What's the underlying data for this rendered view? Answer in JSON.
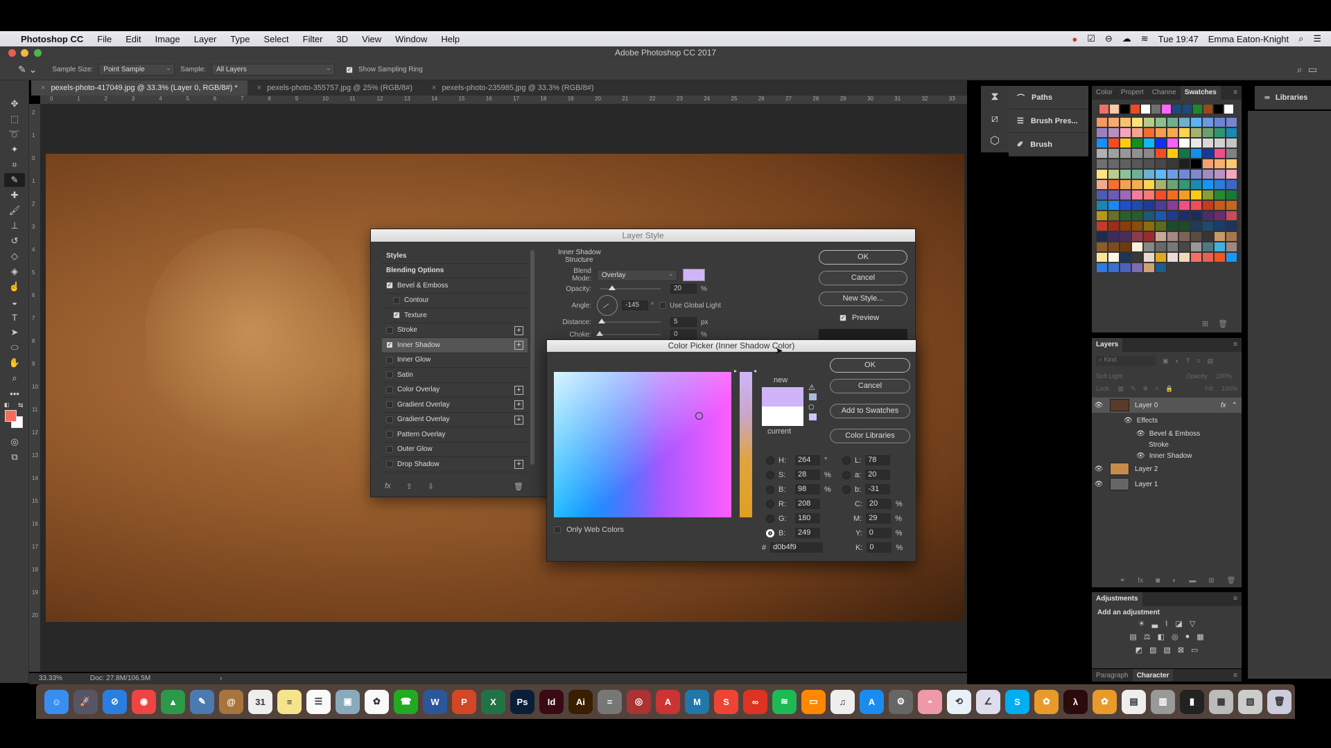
{
  "menubar": {
    "apple": "",
    "app": "Photoshop CC",
    "items": [
      "File",
      "Edit",
      "Image",
      "Layer",
      "Type",
      "Select",
      "Filter",
      "3D",
      "View",
      "Window",
      "Help"
    ],
    "clock": "Tue 19:47",
    "user": "Emma Eaton-Knight"
  },
  "window": {
    "title": "Adobe Photoshop CC 2017"
  },
  "options": {
    "sample_size_label": "Sample Size:",
    "sample_size_value": "Point Sample",
    "sample_label": "Sample:",
    "sample_value": "All Layers",
    "show_ring_label": "Show Sampling Ring",
    "show_ring_checked": true
  },
  "tabs": [
    {
      "label": "pexels-photo-417049.jpg @ 33.3% (Layer 0, RGB/8#) *",
      "active": true
    },
    {
      "label": "pexels-photo-355757.jpg @ 25% (RGB/8#)",
      "active": false
    },
    {
      "label": "pexels-photo-235985.jpg @ 33.3% (RGB/8#)",
      "active": false
    }
  ],
  "ruler_top": [
    "0",
    "1",
    "2",
    "3",
    "4",
    "5",
    "6",
    "7",
    "8",
    "9",
    "10",
    "11",
    "12",
    "13",
    "14",
    "15",
    "16",
    "17",
    "18",
    "19",
    "20",
    "21",
    "22",
    "23",
    "24",
    "25",
    "26",
    "27",
    "28",
    "29",
    "30",
    "31",
    "32",
    "33"
  ],
  "ruler_left": [
    "2",
    "1",
    "0",
    "1",
    "2",
    "3",
    "4",
    "5",
    "6",
    "7",
    "8",
    "9",
    "10",
    "11",
    "12",
    "13",
    "14",
    "15",
    "16",
    "17",
    "18",
    "19",
    "20"
  ],
  "status": {
    "zoom": "33.33%",
    "doc": "Doc: 27.8M/106.5M",
    "arrow": "›"
  },
  "colors": {
    "foreground": "#f26b5b",
    "background": "#ffffff",
    "accent": "#d0b4f9"
  },
  "collapsed_panels": [
    {
      "icon": "paths-icon",
      "label": "Paths"
    },
    {
      "icon": "brush-presets-icon",
      "label": "Brush Pres..."
    },
    {
      "icon": "brush-icon",
      "label": "Brush"
    }
  ],
  "color_panel": {
    "tabs": [
      "Color",
      "Propert",
      "Channe",
      "Swatches"
    ],
    "active_tab": "Swatches",
    "recent": [
      "#f07068",
      "#f6cba8",
      "#000000",
      "#f04a20",
      "#ffffff",
      "#707070",
      "#ff66ff",
      "#1c4a7a",
      "#1c4a7a",
      "#1a8a2a",
      "#9a4a1a",
      "#000000",
      "#ffffff"
    ],
    "swatches": [
      [
        "#f69862",
        "#f8a870",
        "#f9c070",
        "#fce27a",
        "#b8cc8a",
        "#8cc090",
        "#70ae90",
        "#6cb0d0",
        "#5cb4f4",
        "#6c9ae0",
        "#6c84d8",
        "#7884cc"
      ],
      [
        "#9c80c4",
        "#b890c0",
        "#f4a4bc",
        "#f6a48c",
        "#f46c30",
        "#f69c4c",
        "#f6a84c",
        "#fcd44c",
        "#a4b46c",
        "#6ca070",
        "#309470",
        "#1888b4"
      ],
      [
        "#1890f8",
        "#f44c20",
        "#fccc10",
        "#109020",
        "#10b8f4",
        "#1030f8",
        "#f860f8",
        "#ffffff",
        "#e8e8e8",
        "#d8d8d8",
        "#d0d0d0",
        "#c4c4c4"
      ],
      [
        "#b0b0b0",
        "#a0a0a0",
        "#989898",
        "#909090",
        "#888888",
        "#f44c20",
        "#fcc810",
        "#107848",
        "#1090f0",
        "#1838a0",
        "#f44c88",
        "#808080"
      ],
      [
        "#707070",
        "#686868",
        "#606060",
        "#585858",
        "#505050",
        "#484848",
        "#383838",
        "#202020",
        "#000000",
        "#f6a070",
        "#f6b070",
        "#f8c878"
      ],
      [
        "#fce484",
        "#b8cc8c",
        "#8cc098",
        "#70b098",
        "#6cb0d4",
        "#60b8f8",
        "#6c9ce4",
        "#7088d8",
        "#8088cc",
        "#a08cc4",
        "#b894c4",
        "#f4a8c0"
      ],
      [
        "#f6a890",
        "#f47030",
        "#f6a050",
        "#f6ac50",
        "#fcd450",
        "#a4b470",
        "#6ca274",
        "#309874",
        "#188cb4",
        "#1894f8",
        "#2c7cdc",
        "#3c68c4"
      ],
      [
        "#4c5cb4",
        "#6c5cb4",
        "#9c68b8",
        "#f47c9c",
        "#f47c74",
        "#f44c28",
        "#f46c20",
        "#f69c20",
        "#fccc10",
        "#88a030",
        "#288a30",
        "#187838"
      ],
      [
        "#1888b0",
        "#1888f8",
        "#1c50d0",
        "#1c4cb0",
        "#1c3c98",
        "#4c3c98",
        "#8c3c98",
        "#f44c88",
        "#f44c58",
        "#c43c1c",
        "#c45c1c",
        "#c4661c"
      ],
      [
        "#b8981c",
        "#687028",
        "#28602c",
        "#285c2c",
        "#1c5878",
        "#1c58b0",
        "#1c3c8c",
        "#1c2c6c",
        "#1c2c5c",
        "#4c2c6c",
        "#6c2c6c",
        "#c44c5c"
      ],
      [
        "#c43c28",
        "#9c2c1c",
        "#8c3c0c",
        "#8c4c0c",
        "#8c6c0c",
        "#5c6c1c",
        "#1c4c28",
        "#1c4c28",
        "#1c3c5c",
        "#1c4c6c",
        "#1c3c6c",
        "#1c3458"
      ],
      [
        "#1c2c4c",
        "#3c2c5c",
        "#4c2c5c",
        "#8c3c4c",
        "#9c2c2c",
        "#c8a898",
        "#a88880",
        "#7c6458",
        "#5c4c40",
        "#3c3430",
        "#c89868",
        "#a8784c"
      ],
      [
        "#8c5c2c",
        "#7c4c1c",
        "#6c3c0c",
        "#fff0d8",
        "#888888",
        "#686868",
        "#787878",
        "#484848",
        "#989898",
        "#507880",
        "#40b0e0",
        "#a08880"
      ],
      [
        "#fce49c",
        "#fff8e8",
        "#1c3458",
        "#383838",
        "#e8d8d0",
        "#e0a820",
        "#e8dcd4",
        "#f4d8b8",
        "#f47064",
        "#e86050",
        "#f45420",
        "#1898f8"
      ],
      [
        "#2c7ce0",
        "#3c70d0",
        "#4c60c0",
        "#7c6cb0",
        "#d0a070",
        "#1c5c90"
      ]
    ]
  },
  "libraries": {
    "label": "Libraries"
  },
  "layers": {
    "title": "Layers",
    "filter_placeholder": "Kind",
    "blend_mode": "Soft Light",
    "opacity_label": "Opacity:",
    "opacity_value": "100%",
    "lock_label": "Lock:",
    "fill_label": "Fill:",
    "fill_value": "100%",
    "items": [
      {
        "name": "Layer 0",
        "visible": true,
        "fx": "fx",
        "selected": true
      },
      {
        "name": "Effects",
        "visible": true,
        "sub": 1
      },
      {
        "name": "Bevel & Emboss",
        "visible": true,
        "sub": 2
      },
      {
        "name": "Stroke",
        "visible": false,
        "sub": 2
      },
      {
        "name": "Inner Shadow",
        "visible": true,
        "sub": 2
      },
      {
        "name": "Layer 2",
        "visible": true
      },
      {
        "name": "Layer 1",
        "visible": true
      }
    ]
  },
  "adjustments": {
    "title": "Adjustments",
    "subtitle": "Add an adjustment"
  },
  "bottom_tabs": [
    "Paragraph",
    "Character"
  ],
  "layer_style": {
    "title": "Layer Style",
    "list": [
      {
        "label": "Styles",
        "header": true
      },
      {
        "label": "Blending Options",
        "header": true
      },
      {
        "label": "Bevel & Emboss",
        "checked": true
      },
      {
        "label": "Contour",
        "checked": false,
        "indent": true
      },
      {
        "label": "Texture",
        "checked": true,
        "indent": true
      },
      {
        "label": "Stroke",
        "checked": false,
        "plus": true
      },
      {
        "label": "Inner Shadow",
        "checked": true,
        "plus": true,
        "selected": true
      },
      {
        "label": "Inner Glow",
        "checked": false
      },
      {
        "label": "Satin",
        "checked": false
      },
      {
        "label": "Color Overlay",
        "checked": false,
        "plus": true
      },
      {
        "label": "Gradient Overlay",
        "checked": false,
        "plus": true
      },
      {
        "label": "Gradient Overlay",
        "checked": false,
        "plus": true
      },
      {
        "label": "Pattern Overlay",
        "checked": false
      },
      {
        "label": "Outer Glow",
        "checked": false
      },
      {
        "label": "Drop Shadow",
        "checked": false,
        "plus": true
      }
    ],
    "section_title": "Inner Shadow",
    "section_sub": "Structure",
    "blend_mode_label": "Blend Mode:",
    "blend_mode_value": "Overlay",
    "opacity_label": "Opacity:",
    "opacity_value": "20",
    "opacity_unit": "%",
    "opacity_pct": 20,
    "angle_label": "Angle:",
    "angle_value": "-145",
    "angle_unit": "°",
    "global_light_label": "Use Global Light",
    "distance_label": "Distance:",
    "distance_value": "5",
    "distance_unit": "px",
    "choke_label": "Choke:",
    "choke_value": "0",
    "choke_unit": "%",
    "ok": "OK",
    "cancel": "Cancel",
    "new_style": "New Style...",
    "preview_label": "Preview",
    "preview_checked": true
  },
  "color_picker": {
    "title": "Color Picker (Inner Shadow Color)",
    "ok": "OK",
    "cancel": "Cancel",
    "add_swatches": "Add to Swatches",
    "color_libraries": "Color Libraries",
    "new_label": "new",
    "current_label": "current",
    "new_color": "#d0b4f9",
    "current_color": "#ffffff",
    "only_web": "Only Web Colors",
    "H": {
      "label": "H:",
      "value": "264",
      "unit": "°"
    },
    "S": {
      "label": "S:",
      "value": "28",
      "unit": "%"
    },
    "Bv": {
      "label": "B:",
      "value": "98",
      "unit": "%"
    },
    "R": {
      "label": "R:",
      "value": "208"
    },
    "G": {
      "label": "G:",
      "value": "180"
    },
    "Bc": {
      "label": "B:",
      "value": "249"
    },
    "L": {
      "label": "L:",
      "value": "78"
    },
    "a": {
      "label": "a:",
      "value": "20"
    },
    "b": {
      "label": "b:",
      "value": "-31"
    },
    "C": {
      "label": "C:",
      "value": "20",
      "unit": "%"
    },
    "M": {
      "label": "M:",
      "value": "29",
      "unit": "%"
    },
    "Y": {
      "label": "Y:",
      "value": "0",
      "unit": "%"
    },
    "K": {
      "label": "K:",
      "value": "0",
      "unit": "%"
    },
    "hex_label": "#",
    "hex": "d0b4f9"
  },
  "dock": [
    {
      "name": "finder",
      "bg": "#3a8ef0",
      "t": "☺"
    },
    {
      "name": "launchpad",
      "bg": "#556",
      "t": "🚀"
    },
    {
      "name": "safari",
      "bg": "#2a7ee0",
      "t": "⊘"
    },
    {
      "name": "chrome",
      "bg": "#e44",
      "t": "◉"
    },
    {
      "name": "google-drive",
      "bg": "#2a9a4a",
      "t": "▲"
    },
    {
      "name": "preview",
      "bg": "#4a7ab0",
      "t": "✎"
    },
    {
      "name": "contacts",
      "bg": "#a8743c",
      "t": "@"
    },
    {
      "name": "calendar",
      "bg": "#eee",
      "t": "31"
    },
    {
      "name": "notes",
      "bg": "#f6e48c",
      "t": "≡"
    },
    {
      "name": "reminders",
      "bg": "#fafafa",
      "t": "☰"
    },
    {
      "name": "image-capture",
      "bg": "#8ab",
      "t": "▣"
    },
    {
      "name": "photos",
      "bg": "#f9f9f9",
      "t": "✿"
    },
    {
      "name": "facetime",
      "bg": "#2a2",
      "t": "☎"
    },
    {
      "name": "word",
      "bg": "#2b579a",
      "t": "W"
    },
    {
      "name": "powerpoint",
      "bg": "#d24726",
      "t": "P"
    },
    {
      "name": "excel",
      "bg": "#217346",
      "t": "X"
    },
    {
      "name": "photoshop",
      "bg": "#0a1e38",
      "t": "Ps"
    },
    {
      "name": "indesign",
      "bg": "#3a0a14",
      "t": "Id"
    },
    {
      "name": "illustrator",
      "bg": "#3a1e00",
      "t": "Ai"
    },
    {
      "name": "calculator",
      "bg": "#777",
      "t": "="
    },
    {
      "name": "photo-booth",
      "bg": "#a33",
      "t": "◎"
    },
    {
      "name": "autocad",
      "bg": "#c33",
      "t": "A"
    },
    {
      "name": "maya",
      "bg": "#27a",
      "t": "M"
    },
    {
      "name": "sketchup",
      "bg": "#e43",
      "t": "S"
    },
    {
      "name": "creative-cloud",
      "bg": "#d32",
      "t": "∞"
    },
    {
      "name": "spotify",
      "bg": "#1db954",
      "t": "≋"
    },
    {
      "name": "ibooks",
      "bg": "#f80",
      "t": "▭"
    },
    {
      "name": "itunes",
      "bg": "#eee",
      "t": "♫"
    },
    {
      "name": "app-store",
      "bg": "#1a8cf0",
      "t": "A"
    },
    {
      "name": "system-preferences",
      "bg": "#666",
      "t": "⚙"
    },
    {
      "name": "sierra",
      "bg": "#e9a",
      "t": "◓"
    },
    {
      "name": "time-machine",
      "bg": "#e8f0f8",
      "t": "⟲"
    },
    {
      "name": "screenflow",
      "bg": "#dde",
      "t": "∠"
    },
    {
      "name": "skype",
      "bg": "#00aff0",
      "t": "S"
    },
    {
      "name": "pinwheel",
      "bg": "#e89a2a",
      "t": "✿"
    },
    {
      "name": "acrobat",
      "bg": "#2a0a0a",
      "t": "λ"
    },
    {
      "name": "pinwheel-2",
      "bg": "#e89a2a",
      "t": "✿"
    },
    {
      "name": "document",
      "bg": "#eee",
      "t": "▤"
    },
    {
      "name": "disk",
      "bg": "#999",
      "t": "▥"
    },
    {
      "name": "terminal",
      "bg": "#222",
      "t": "▮"
    },
    {
      "name": "screenshot",
      "bg": "#bbb",
      "t": "▦"
    },
    {
      "name": "folder",
      "bg": "#ccc",
      "t": "▧"
    },
    {
      "name": "trash",
      "bg": "#ccd",
      "t": "🗑"
    }
  ]
}
